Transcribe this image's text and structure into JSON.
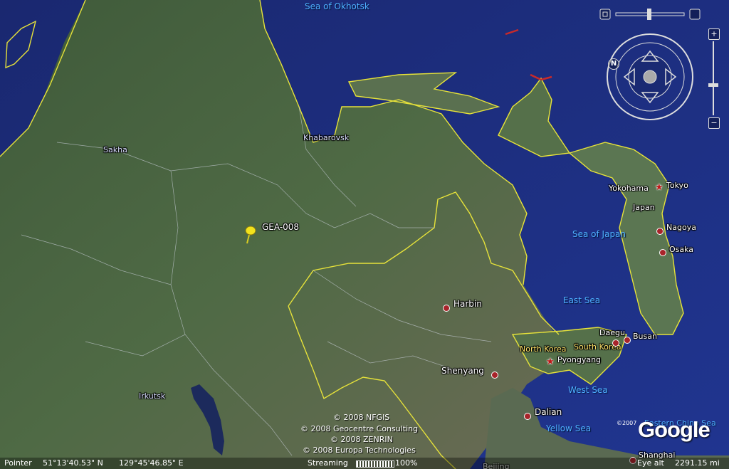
{
  "map": {
    "placemark": {
      "label": "GEA-008",
      "color": "#f2e21c"
    },
    "water_labels": {
      "sea_of_okhotsk": "Sea of Okhotsk",
      "sea_of_japan": "Sea of Japan",
      "east_sea": "East Sea",
      "west_sea": "West Sea",
      "yellow_sea": "Yellow Sea",
      "east_china_sea": "Eastern China Sea"
    },
    "regions": {
      "sakha": "Sakha",
      "khabarovsk": "Khabarovsk",
      "irkutsk": "Irkutsk"
    },
    "countries": {
      "japan": "Japan",
      "north_korea": "North Korea",
      "south_korea": "South Korea"
    },
    "cities": {
      "tokyo": "Tokyo",
      "yokohama": "Yokohama",
      "nagoya": "Nagoya",
      "osaka": "Osaka",
      "harbin": "Harbin",
      "daegu": "Daegu",
      "busan": "Busan",
      "pyongyang": "Pyongyang",
      "shenyang": "Shenyang",
      "dalian": "Dalian",
      "shanghai": "Shanghai",
      "beijing": "Beijing"
    },
    "credits": [
      "© 2008 NFGIS",
      "© 2008 Geocentre Consulting",
      "© 2008 ZENRIN",
      "© 2008 Europa Technologies"
    ],
    "logo_text": "Google",
    "logo_copyright": "©2007",
    "border_color": "#e6e23a",
    "ocean_color": "#1d2b78"
  },
  "controls": {
    "compass_north": "N",
    "zoom_in": "+",
    "zoom_out": "−",
    "zoom_level": 0.4
  },
  "status": {
    "pointer_label": "Pointer",
    "latitude": "51°13'40.53\" N",
    "longitude": "129°45'46.85\" E",
    "streaming_label": "Streaming",
    "streaming_percent": "100%",
    "eye_alt_label": "Eye alt",
    "eye_alt_value": "2291.15 mi"
  }
}
